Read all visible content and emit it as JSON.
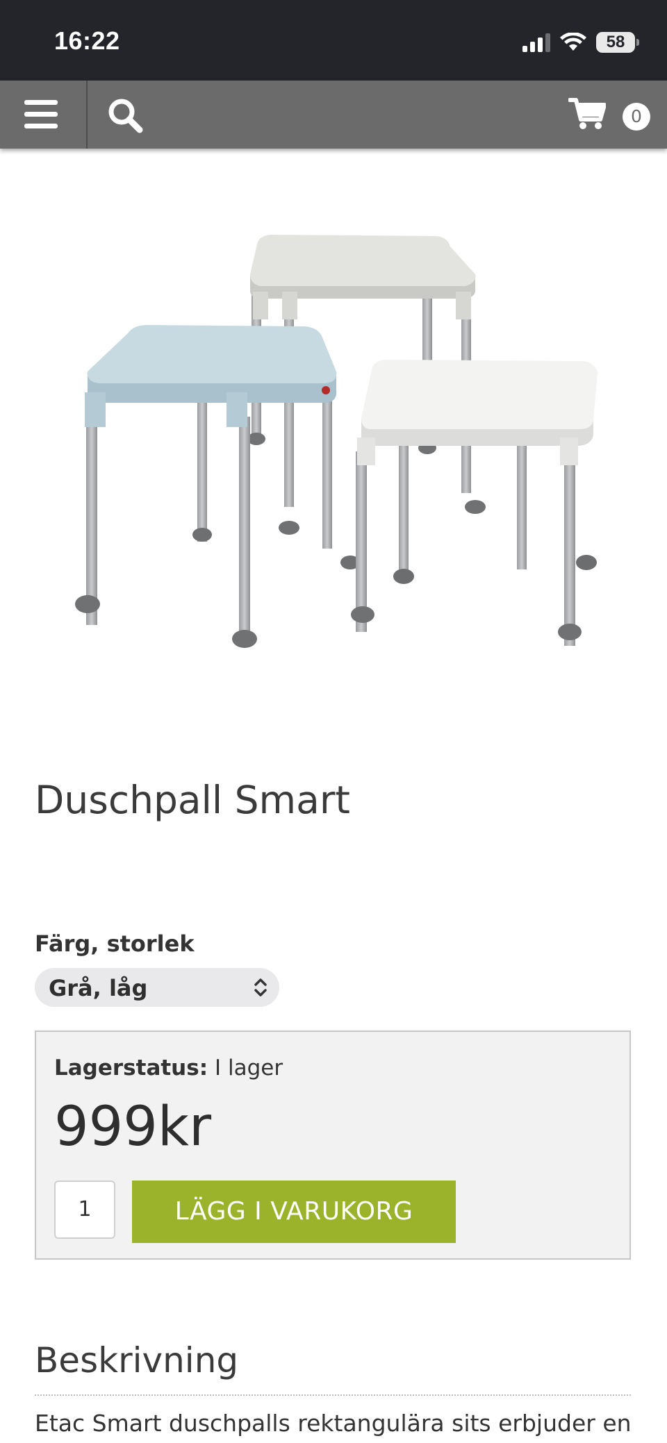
{
  "status_bar": {
    "time": "16:22",
    "battery": "58"
  },
  "navbar": {
    "menu_icon": "hamburger-icon",
    "search_icon": "search-icon",
    "cart_icon": "cart-icon",
    "cart_count": "0"
  },
  "product": {
    "image_icon": "shower-stools-image",
    "title": "Duschpall Smart",
    "variant": {
      "label": "Färg, storlek",
      "selected": "Grå, låg"
    },
    "stock": {
      "label": "Lagerstatus:",
      "value": "I lager"
    },
    "price": "999kr",
    "quantity": "1",
    "add_to_cart": "LÄGG I VARUKORG"
  },
  "description": {
    "heading": "Beskrivning",
    "text": "Etac Smart duschpalls rektangulära sits erbjuder en"
  },
  "colors": {
    "nav_bg": "#6b6b6b",
    "status_bg": "#23252b",
    "accent_green": "#9bb22b",
    "buybox_bg": "#f2f2f2"
  }
}
